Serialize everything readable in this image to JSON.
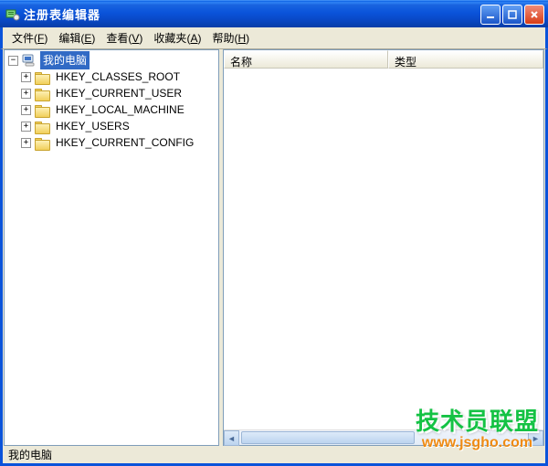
{
  "window": {
    "title": "注册表编辑器"
  },
  "menu": {
    "file": {
      "label": "文件",
      "acc": "F"
    },
    "edit": {
      "label": "编辑",
      "acc": "E"
    },
    "view": {
      "label": "查看",
      "acc": "V"
    },
    "fav": {
      "label": "收藏夹",
      "acc": "A"
    },
    "help": {
      "label": "帮助",
      "acc": "H"
    }
  },
  "tree": {
    "root": {
      "label": "我的电脑",
      "expander": "−",
      "selected": true
    },
    "items": [
      {
        "label": "HKEY_CLASSES_ROOT",
        "expander": "+"
      },
      {
        "label": "HKEY_CURRENT_USER",
        "expander": "+"
      },
      {
        "label": "HKEY_LOCAL_MACHINE",
        "expander": "+"
      },
      {
        "label": "HKEY_USERS",
        "expander": "+"
      },
      {
        "label": "HKEY_CURRENT_CONFIG",
        "expander": "+"
      }
    ]
  },
  "list": {
    "columns": {
      "name": "名称",
      "type": "类型"
    },
    "rows": []
  },
  "status": {
    "path": "我的电脑"
  },
  "watermark": {
    "line1": "技术员联盟",
    "line2": "www.jsgho.com"
  }
}
